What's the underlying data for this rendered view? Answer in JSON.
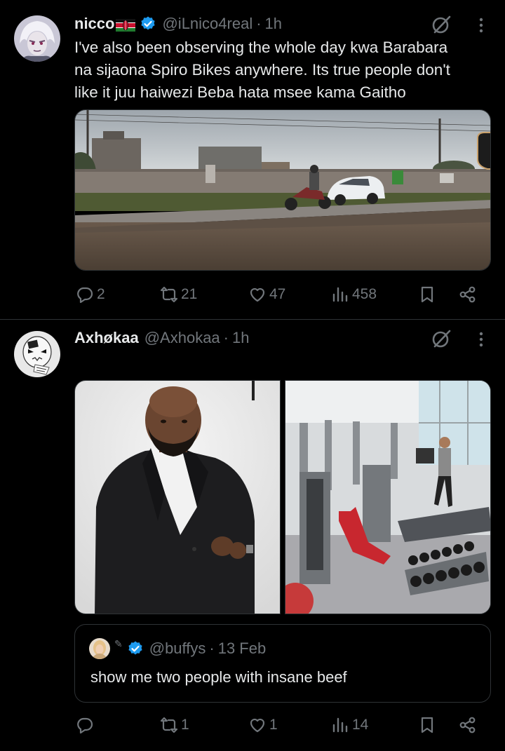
{
  "tweets": [
    {
      "author_name": "nicco",
      "handle": "@iLnico4real",
      "separator": "·",
      "time": "1h",
      "text_lines": [
        "I've also been observing the whole day kwa Barabara",
        "na sijaona Spiro Bikes anywhere.  Its true people don't",
        "like it juu haiwezi Beba hata msee kama Gaitho"
      ],
      "media": [
        "roadside-photo"
      ],
      "stats": {
        "replies": "2",
        "reposts": "21",
        "likes": "47",
        "views": "458"
      }
    },
    {
      "author_name": "Axhøkaa",
      "handle": "@Axhokaa",
      "separator": "·",
      "time": "1h",
      "media": [
        "man-in-suit-photo",
        "gym-photo"
      ],
      "quoted": {
        "handle": "@buffys",
        "separator": "·",
        "time": "13 Feb",
        "text": "show me two people with insane beef"
      },
      "stats": {
        "replies": "",
        "reposts": "1",
        "likes": "1",
        "views": "14"
      }
    }
  ],
  "colors": {
    "background": "#000000",
    "text_primary": "#e7e9ea",
    "text_secondary": "#71767b",
    "verified_blue": "#1d9bf0",
    "border": "#2f3336"
  },
  "icons": [
    "reply-icon",
    "repost-icon",
    "like-icon",
    "views-icon",
    "bookmark-icon",
    "share-icon",
    "grok-icon",
    "more-icon",
    "verified-icon",
    "kenya-flag-icon"
  ]
}
